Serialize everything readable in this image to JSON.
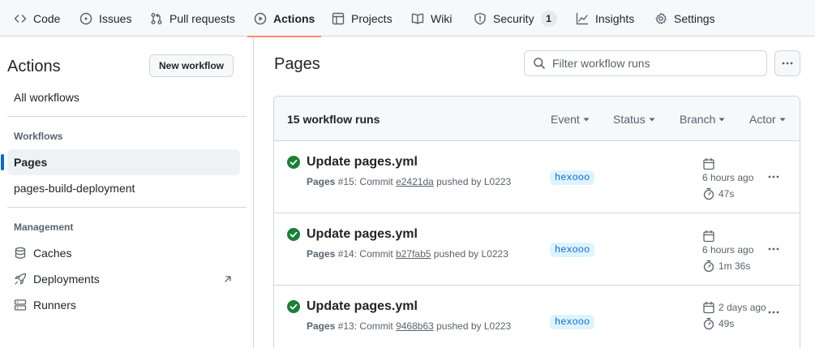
{
  "nav": {
    "tabs": [
      {
        "label": "Code",
        "icon": "code-icon"
      },
      {
        "label": "Issues",
        "icon": "issue-opened-icon"
      },
      {
        "label": "Pull requests",
        "icon": "git-pull-request-icon"
      },
      {
        "label": "Actions",
        "icon": "play-icon",
        "active": true
      },
      {
        "label": "Projects",
        "icon": "table-icon"
      },
      {
        "label": "Wiki",
        "icon": "book-icon"
      },
      {
        "label": "Security",
        "icon": "shield-icon",
        "counter": "1"
      },
      {
        "label": "Insights",
        "icon": "graph-icon"
      },
      {
        "label": "Settings",
        "icon": "gear-icon"
      }
    ]
  },
  "sidebar": {
    "title": "Actions",
    "new_workflow_label": "New workflow",
    "all_workflows": "All workflows",
    "workflows_heading": "Workflows",
    "workflows": [
      {
        "label": "Pages",
        "selected": true
      },
      {
        "label": "pages-build-deployment",
        "selected": false
      }
    ],
    "management_heading": "Management",
    "management": [
      {
        "label": "Caches",
        "icon": "database-icon"
      },
      {
        "label": "Deployments",
        "icon": "rocket-icon",
        "external": true
      },
      {
        "label": "Runners",
        "icon": "server-icon"
      }
    ]
  },
  "main": {
    "title": "Pages",
    "filter_placeholder": "Filter workflow runs",
    "runs_count": "15 workflow runs",
    "filters": [
      "Event",
      "Status",
      "Branch",
      "Actor"
    ],
    "runs": [
      {
        "title": "Update pages.yml",
        "workflow": "Pages",
        "number": "#15",
        "commit_prefix": ": Commit ",
        "commit": "e2421da",
        "pushed_by": " pushed by L0223",
        "branch": "hexooo",
        "when": "6 hours ago",
        "duration": "47s",
        "status": "success"
      },
      {
        "title": "Update pages.yml",
        "workflow": "Pages",
        "number": "#14",
        "commit_prefix": ": Commit ",
        "commit": "b27fab5",
        "pushed_by": " pushed by L0223",
        "branch": "hexooo",
        "when": "6 hours ago",
        "duration": "1m 36s",
        "status": "success"
      },
      {
        "title": "Update pages.yml",
        "workflow": "Pages",
        "number": "#13",
        "commit_prefix": ": Commit ",
        "commit": "9468b63",
        "pushed_by": " pushed by L0223",
        "branch": "hexooo",
        "when": "2 days ago",
        "duration": "49s",
        "status": "success"
      }
    ]
  },
  "colors": {
    "accent": "#0969da",
    "success": "#1a7f37",
    "active_tab_underline": "#fd8c73",
    "branch_bg": "#ddf4ff"
  }
}
